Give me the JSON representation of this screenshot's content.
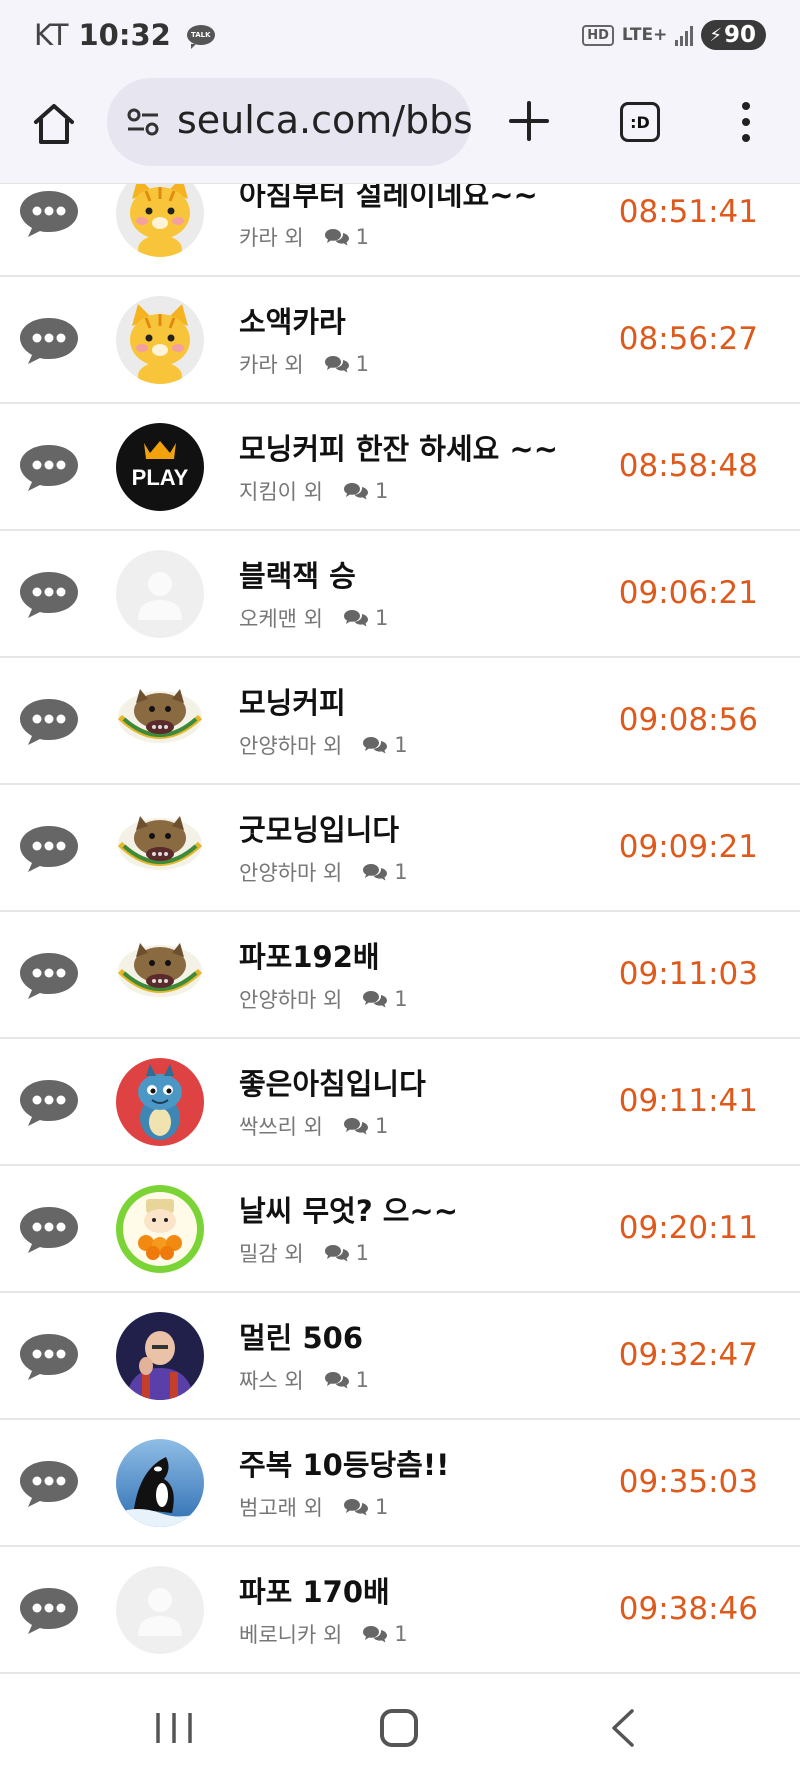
{
  "status_bar": {
    "carrier": "KT",
    "time": "10:32",
    "talk_label": "TALK",
    "hd_label": "HD",
    "network": "LTE+",
    "battery": "90"
  },
  "browser": {
    "url": "seulca.com/bbs",
    "tabs_label": ":D"
  },
  "colors": {
    "time_accent": "#dd5a1c",
    "icon_gray": "#666666"
  },
  "rows": [
    {
      "title": "아침부터 설레이네요~~",
      "author": "카라 외",
      "comments": "1",
      "time": "08:51:41",
      "avatar": "tiger"
    },
    {
      "title": "소액카라",
      "author": "카라 외",
      "comments": "1",
      "time": "08:56:27",
      "avatar": "tiger"
    },
    {
      "title": "모닝커피 한잔 하세요 ~~",
      "author": "지킴이 외",
      "comments": "1",
      "time": "08:58:48",
      "avatar": "play",
      "avatar_text": "PLAY"
    },
    {
      "title": "블랙잭 승",
      "author": "오케맨 외",
      "comments": "1",
      "time": "09:06:21",
      "avatar": "default"
    },
    {
      "title": "모닝커피",
      "author": "안양하마 외",
      "comments": "1",
      "time": "09:08:56",
      "avatar": "cat"
    },
    {
      "title": "굿모닝입니다",
      "author": "안양하마 외",
      "comments": "1",
      "time": "09:09:21",
      "avatar": "cat"
    },
    {
      "title": "파포192배",
      "author": "안양하마 외",
      "comments": "1",
      "time": "09:11:03",
      "avatar": "cat"
    },
    {
      "title": "좋은아침입니다",
      "author": "싹쓰리 외",
      "comments": "1",
      "time": "09:11:41",
      "avatar": "dragon"
    },
    {
      "title": "날씨 무엇? 으~~",
      "author": "밀감 외",
      "comments": "1",
      "time": "09:20:11",
      "avatar": "orange"
    },
    {
      "title": "멀린 506",
      "author": "짜스 외",
      "comments": "1",
      "time": "09:32:47",
      "avatar": "man"
    },
    {
      "title": "주복 10등당츰!!",
      "author": "범고래 외",
      "comments": "1",
      "time": "09:35:03",
      "avatar": "orca"
    },
    {
      "title": "파포 170배",
      "author": "베로니카 외",
      "comments": "1",
      "time": "09:38:46",
      "avatar": "default"
    }
  ]
}
